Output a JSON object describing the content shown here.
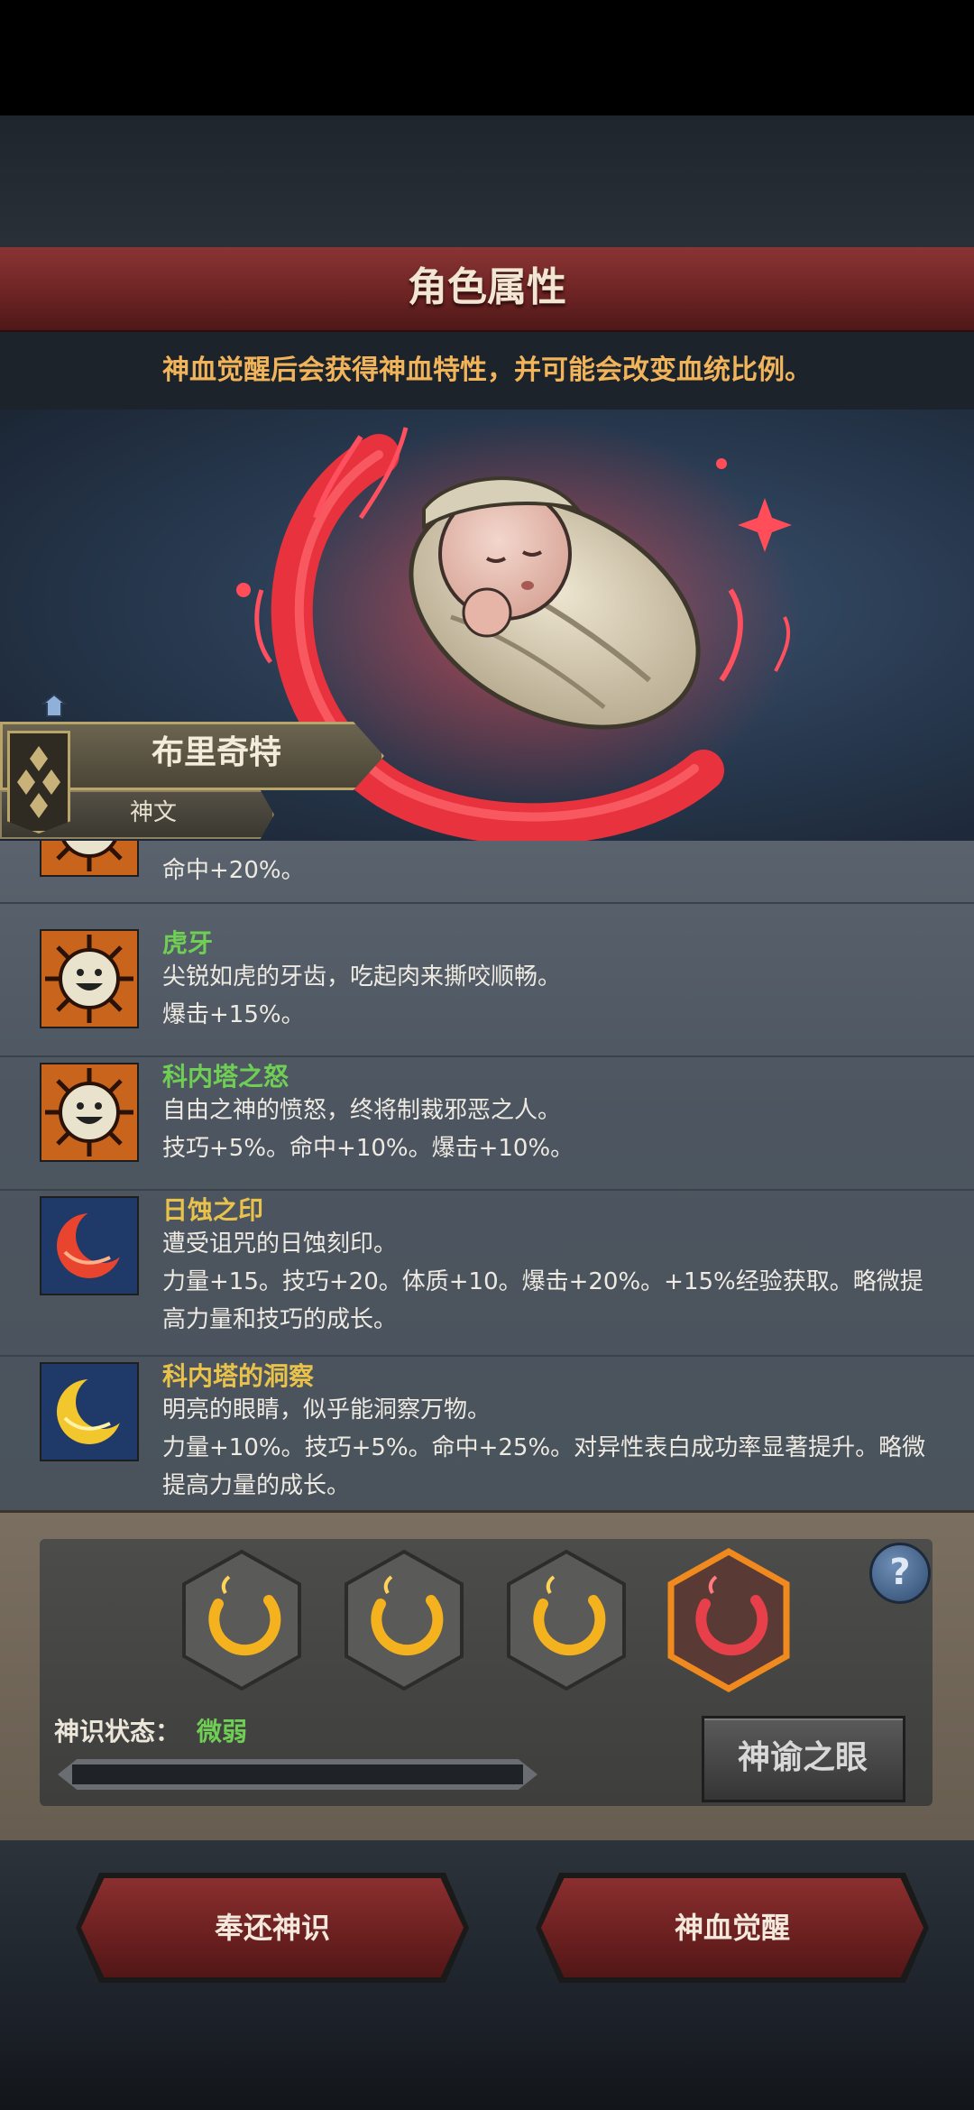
{
  "header": {
    "title": "角色属性",
    "subtitle": "神血觉醒后会获得神血特性，并可能会改变血统比例。"
  },
  "hero": {
    "name": "布里奇特",
    "class": "神文"
  },
  "traits": [
    {
      "name": "",
      "description": "",
      "effect": "命中+20%。",
      "name_color": "#6fcf55",
      "icon": "smiley-sun-icon"
    },
    {
      "name": "虎牙",
      "description": "尖锐如虎的牙齿，吃起肉来撕咬顺畅。",
      "effect": "爆击+15%。",
      "name_color": "#6fcf55",
      "icon": "smiley-sun-icon"
    },
    {
      "name": "科内塔之怒",
      "description": "自由之神的愤怒，终将制裁邪恶之人。",
      "effect": "技巧+5%。命中+10%。爆击+10%。",
      "name_color": "#6fcf55",
      "icon": "smiley-sun-icon"
    },
    {
      "name": "日蚀之印",
      "description": "遭受诅咒的日蚀刻印。",
      "effect": "力量+15。技巧+20。体质+10。爆击+20%。+15%经验获取。略微提高力量和技巧的成长。",
      "name_color": "#e8c24a",
      "icon": "red-crescent-icon"
    },
    {
      "name": "科内塔的洞察",
      "description": "明亮的眼睛，似乎能洞察万物。",
      "effect": "力量+10%。技巧+5%。命中+25%。对异性表白成功率显著提升。略微提高力量的成长。",
      "name_color": "#e8c24a",
      "icon": "gold-crescent-icon"
    }
  ],
  "awakening": {
    "slots": [
      {
        "icon": "gold-crescent-icon",
        "state": "filled"
      },
      {
        "icon": "gold-crescent-icon",
        "state": "filled"
      },
      {
        "icon": "gold-crescent-icon",
        "state": "filled"
      },
      {
        "icon": "red-crescent-icon",
        "state": "selected"
      }
    ],
    "state_label": "神识状态：",
    "state_value": "微弱",
    "progress": 0.0,
    "oracle_button": "神谕之眼",
    "help": "?"
  },
  "footer": {
    "return_button": "奉还神识",
    "awaken_button": "神血觉醒"
  },
  "colors": {
    "accent_orange": "#f2b45a",
    "trait_green": "#6fcf55",
    "trait_gold": "#e8c24a",
    "header_red": "#7a2a2a"
  }
}
